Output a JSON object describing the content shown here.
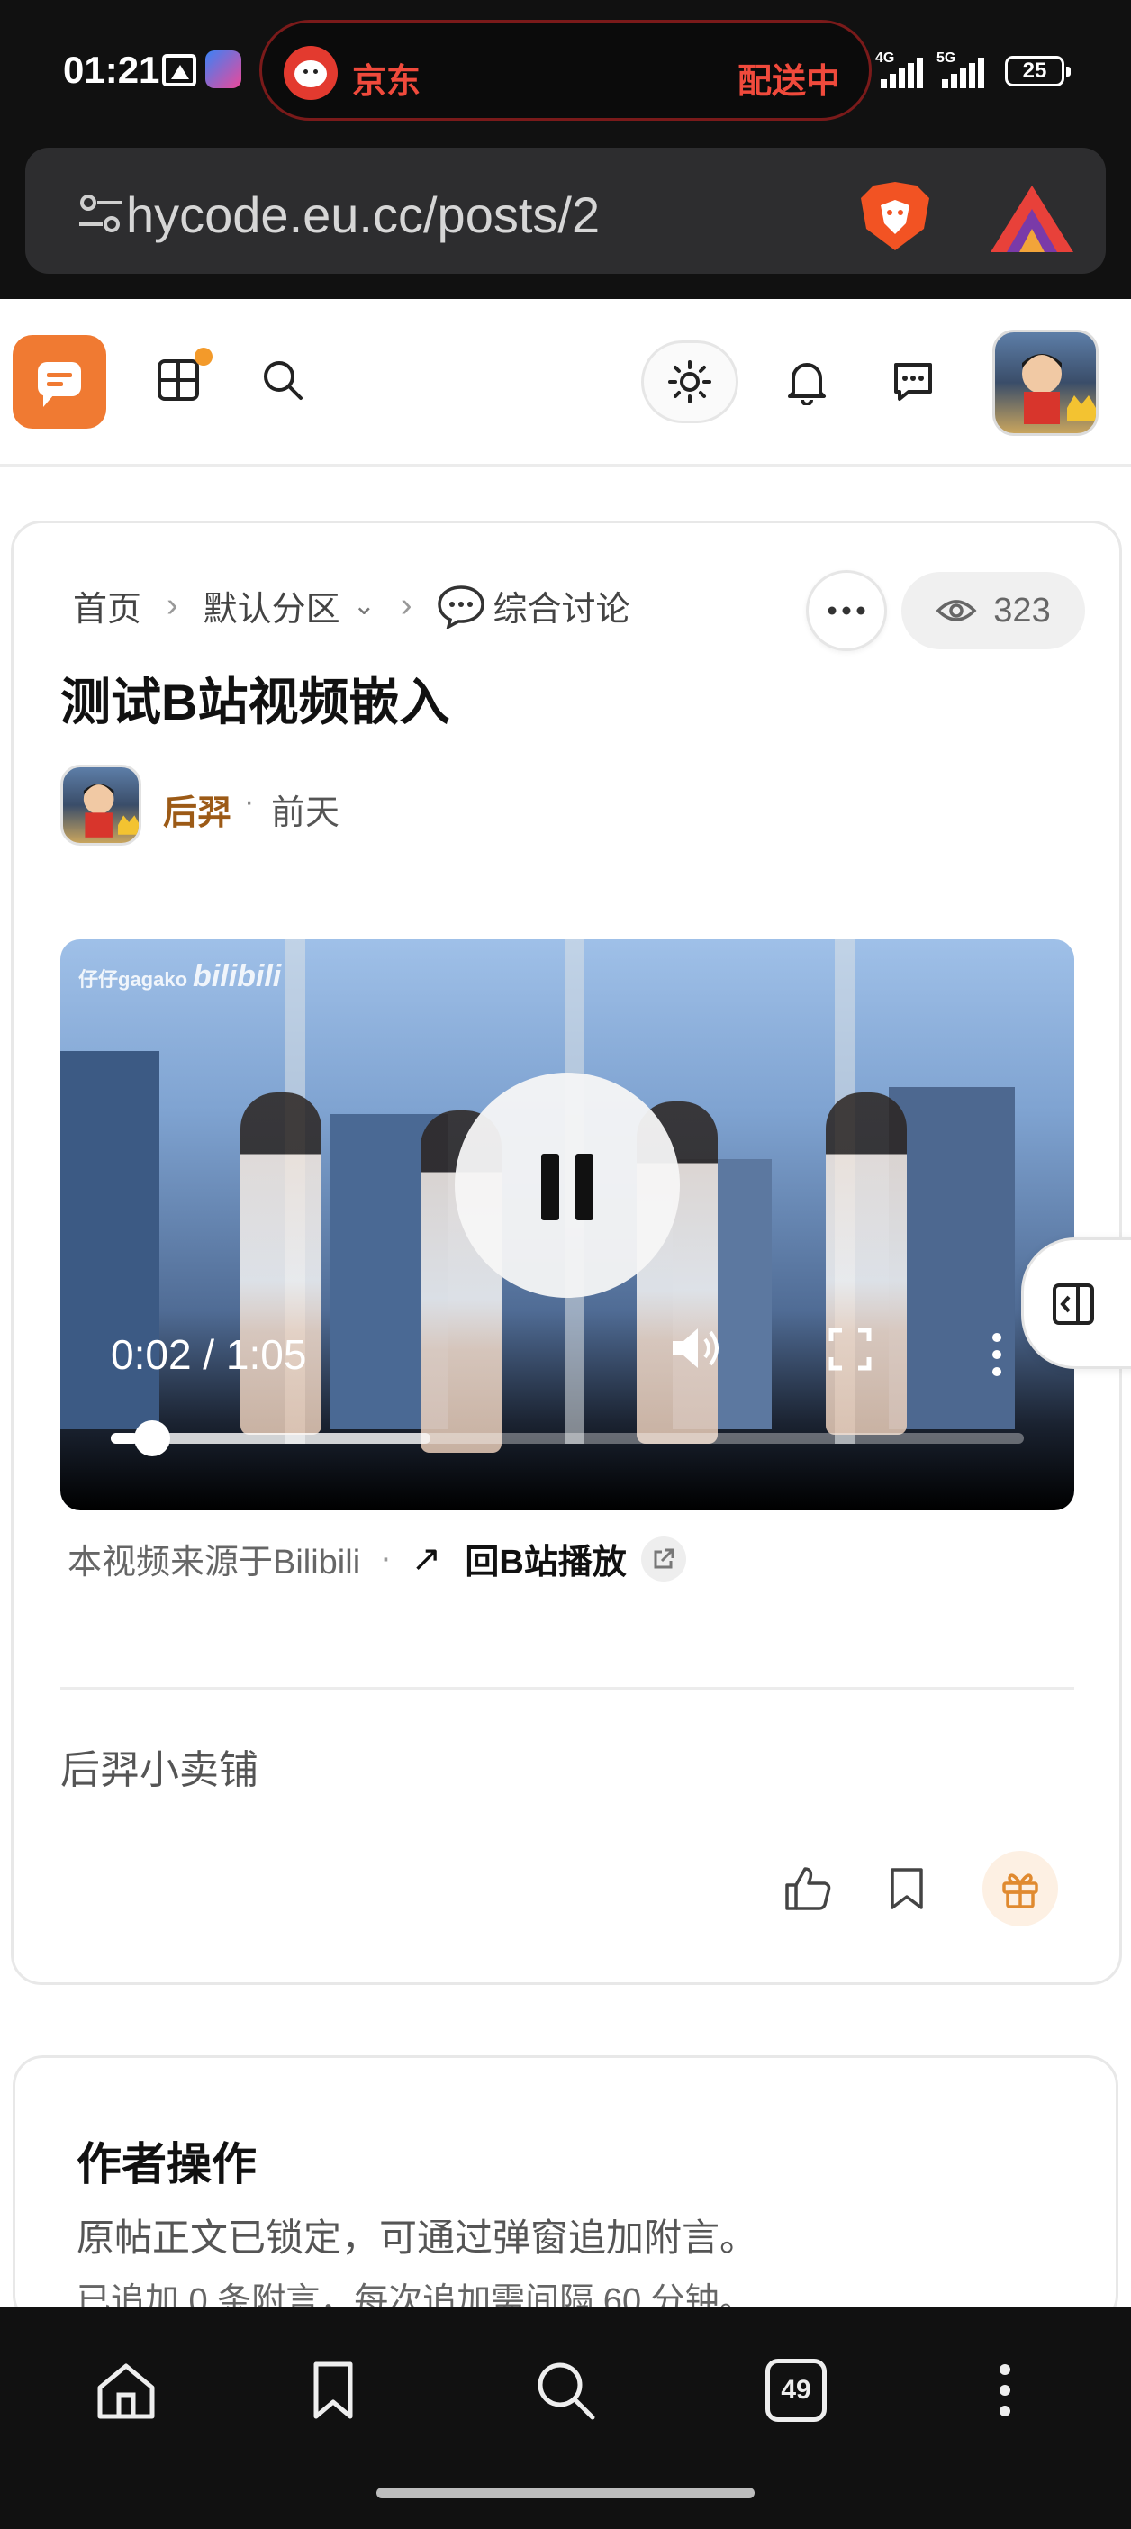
{
  "status_bar": {
    "time": "01:21",
    "live_app_name": "京东",
    "live_app_status": "配送中",
    "network_1": "4G",
    "network_2": "5G",
    "battery": "25"
  },
  "browser": {
    "url": "hycode.eu.cc/posts/2",
    "tab_count": "49"
  },
  "post": {
    "breadcrumb": [
      "首页",
      "默认分区",
      "综合讨论"
    ],
    "views": "323",
    "title": "测试B站视频嵌入",
    "author": "后羿",
    "time": "前天",
    "video": {
      "watermark": "仔仔gagako",
      "watermark_brand": "bilibili",
      "time_display": "0:02 / 1:05",
      "played_fraction": 0.03,
      "buffered_fraction": 0.35
    },
    "video_source": "本视频来源于Bilibili",
    "back_to_bilibili": "回B站播放",
    "shop_text": "后羿小卖铺"
  },
  "author_ops": {
    "title": "作者操作",
    "line1": "原帖正文已锁定，可通过弹窗追加附言。",
    "line2": "已追加 0 条附言，每次追加需间隔 60 分钟。"
  },
  "colors": {
    "accent_orange": "#f07a32",
    "author_name": "#9c5a16",
    "jd_red": "#f04a3c"
  }
}
